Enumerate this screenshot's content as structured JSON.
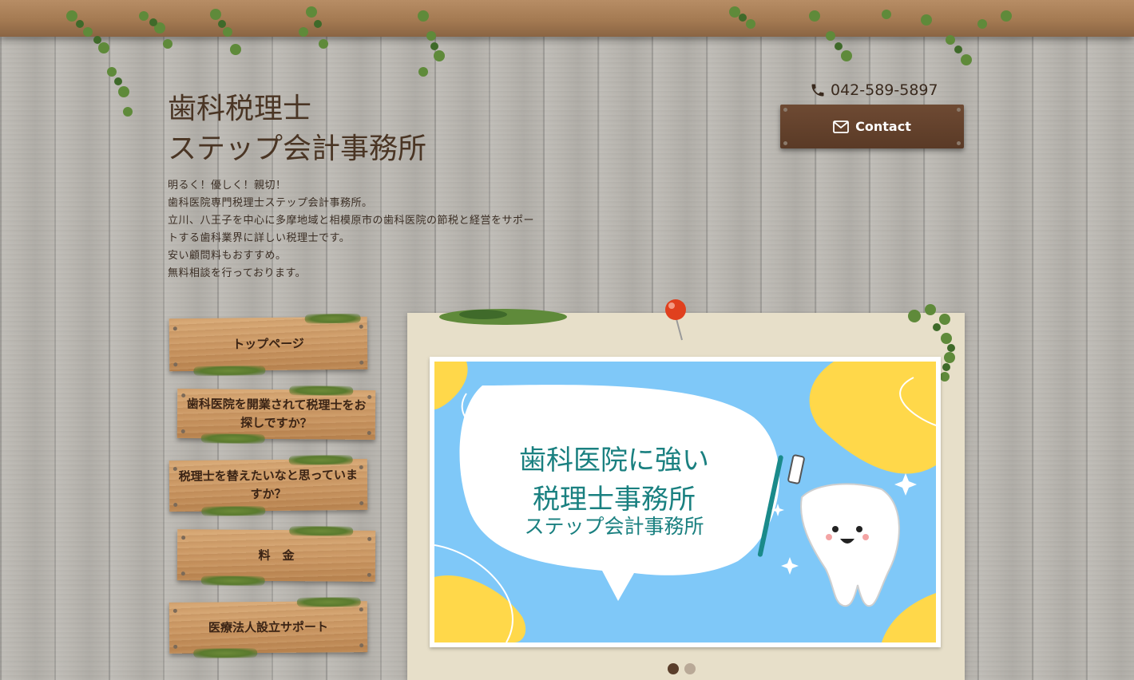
{
  "header": {
    "title_line1": "歯科税理士",
    "title_line2": "ステップ会計事務所",
    "phone": "042-589-5897",
    "contact_label": "Contact"
  },
  "intro": [
    "明るく！優しく！親切！",
    "歯科医院専門税理士ステップ会計事務所。",
    "立川、八王子を中心に多摩地域と相模原市の歯科医院の節税と経営をサポー",
    "トする歯科業界に詳しい税理士です。",
    "安い顧問料もおすすめ。",
    "無料相談を行っております。"
  ],
  "nav": {
    "items": [
      {
        "label": "トップページ"
      },
      {
        "label": "歯科医院を開業されて税理士をお探しですか？"
      },
      {
        "label": "税理士を替えたいなと思っていますか？"
      },
      {
        "label": "料　金"
      },
      {
        "label": "医療法人設立サポート"
      }
    ]
  },
  "slider": {
    "line1": "歯科医院に強い",
    "line2": "税理士事務所",
    "line3": "ステップ会計事務所",
    "current_slide": 1,
    "slide_count": 2
  },
  "colors": {
    "banner_bg": "#7fc8f8",
    "banner_text": "#1a8080",
    "accent_yellow": "#ffd84a",
    "wood_dark": "#5a3a26",
    "plank": "#c89460"
  },
  "icons": {
    "phone": "phone-icon",
    "contact": "envelope-icon"
  }
}
